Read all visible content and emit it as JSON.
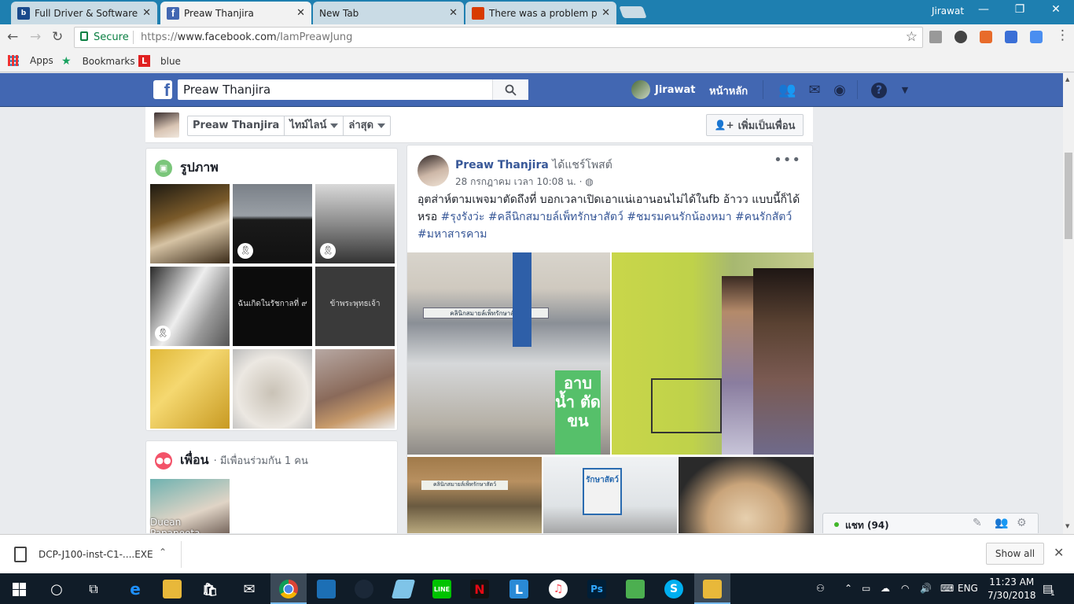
{
  "browser": {
    "tabs": [
      {
        "label": "Full Driver & Software Pa",
        "favicon": "brother-icon",
        "color": "#1a4a8c"
      },
      {
        "label": "Preaw Thanjira",
        "favicon": "facebook-icon",
        "color": "#4267b2",
        "active": true
      },
      {
        "label": "New Tab",
        "favicon": "",
        "color": ""
      },
      {
        "label": "There was a problem pro",
        "favicon": "office-icon",
        "color": "#d83b01"
      }
    ],
    "profile": "Jirawat",
    "secure_label": "Secure",
    "url_prefix": "https://",
    "url_domain": "www.facebook.com",
    "url_path": "/IamPreawJung",
    "bookmarks": {
      "apps": "Apps",
      "bookmarks": "Bookmarks",
      "blue": "blue"
    }
  },
  "fb": {
    "search_value": "Preaw Thanjira",
    "user_name": "Jirawat",
    "home": "หน้าหลัก",
    "subnav": {
      "name": "Preaw Thanjira",
      "timeline": "ไทม์ไลน์",
      "recent": "ล่าสุด",
      "add_friend": "เพิ่มเป็นเพื่อน"
    },
    "photos": {
      "title": "รูปภาพ",
      "tiles": [
        {
          "caption": ""
        },
        {
          "caption": ""
        },
        {
          "caption": ""
        },
        {
          "caption": ""
        },
        {
          "caption": "ฉันเกิดในรัชกาลที่ ๙"
        },
        {
          "caption": "ข้าพระพุทธเจ้า"
        },
        {
          "caption": ""
        },
        {
          "caption": ""
        },
        {
          "caption": ""
        }
      ]
    },
    "friends": {
      "title": "เพื่อน",
      "subtitle": "· มีเพื่อนร่วมกัน 1 คน",
      "friend_name": "Duean Papapeeta"
    },
    "post": {
      "author": "Preaw Thanjira",
      "action": "ได้แชร์โพสต์",
      "time": "28 กรกฎาคม เวลา 10:08 น. ·",
      "text": "อุตส่าห์ตามเพจมาตัดถึงที่ บอกเวลาเปิดเอาแน่เอานอนไม่ได้ในfb อ้าวว แบบนี้ก็ได้หรอ",
      "tags": [
        "#รุงรังว่ะ",
        "#คลีนิกสมายล์เพ็ทรักษาสัตว์",
        "#ชมรมคนรักน้องหมา",
        "#คนรักสัตว์",
        "#มหาสารคาม"
      ],
      "sign_text": "อาบ น้ำ ตัด ขน",
      "clinic_text": "คลินิกสมายล์เพ็ทรักษาสัตว์",
      "sign2_text": "รักษาสัตว์"
    },
    "chat": {
      "label": "แชท (94)"
    }
  },
  "downloads": {
    "file": "DCP-J100-inst-C1-....EXE",
    "show_all": "Show all"
  },
  "taskbar": {
    "lang": "ENG",
    "time": "11:23 AM",
    "date": "7/30/2018",
    "notif": "1"
  }
}
